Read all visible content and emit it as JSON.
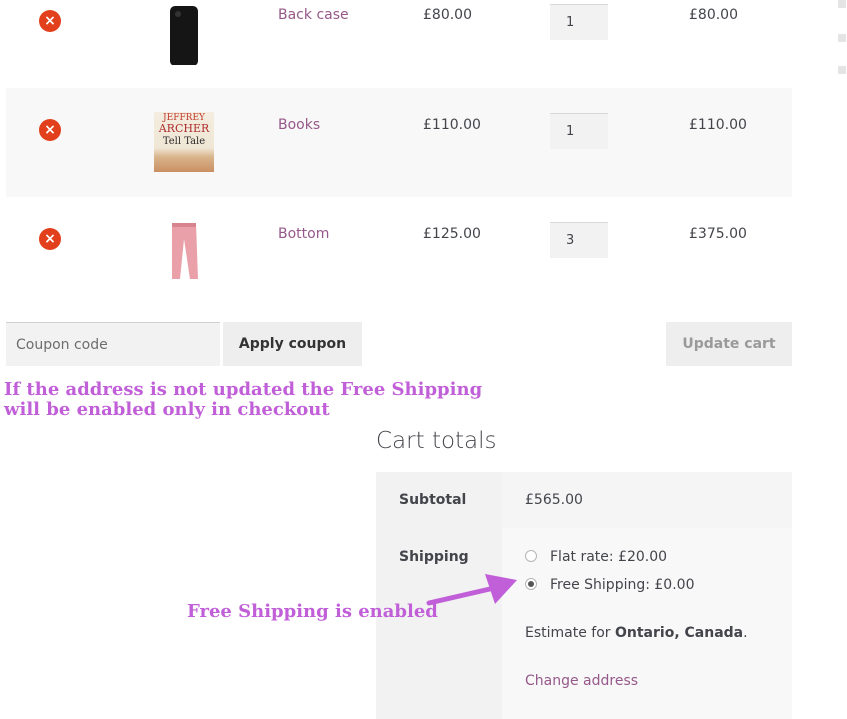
{
  "cart_items": [
    {
      "name": "Back case",
      "price": "£80.00",
      "quantity": "1",
      "subtotal": "£80.00",
      "remove_symbol": "×"
    },
    {
      "name": "Books",
      "price": "£110.00",
      "quantity": "1",
      "subtotal": "£110.00",
      "remove_symbol": "×"
    },
    {
      "name": "Bottom",
      "price": "£125.00",
      "quantity": "3",
      "subtotal": "£375.00",
      "remove_symbol": "×"
    }
  ],
  "book_cover": {
    "author_top": "JEFFREY",
    "author_main": "ARCHER",
    "title": "Tell Tale"
  },
  "actions": {
    "coupon_placeholder": "Coupon code",
    "apply_label": "Apply coupon",
    "update_label": "Update cart"
  },
  "note_text": "If the address is not updated the Free Shipping will be enabled only in checkout",
  "cart_totals": {
    "title": "Cart totals",
    "subtotal_label": "Subtotal",
    "subtotal_value": "£565.00",
    "shipping_label": "Shipping",
    "options": [
      {
        "label": "Flat rate: £20.00",
        "selected": false
      },
      {
        "label": "Free Shipping: £0.00",
        "selected": true
      }
    ],
    "estimate_prefix": "Estimate for",
    "estimate_location": "Ontario, Canada",
    "estimate_suffix": ".",
    "change_address": "Change address"
  },
  "annotation_text": "Free Shipping is enabled",
  "colors": {
    "accent": "#96588a",
    "remove": "#e2401c",
    "annotation": "#c15fd8"
  }
}
